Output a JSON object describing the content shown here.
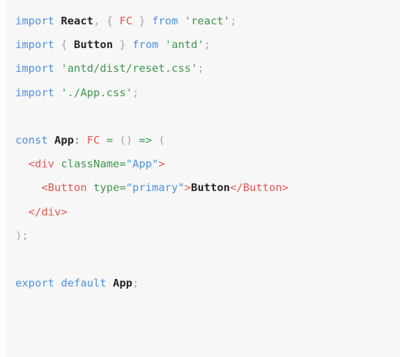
{
  "editor": {
    "language": "tsx",
    "background_color": "#f7f7f7",
    "default_text_color": "#333333",
    "theme_colors": {
      "keyword": "#4b90e2",
      "string": "#3f9650",
      "type": "#e8564f",
      "punctuation": "#a6a6a6",
      "identifier": "#262626",
      "operator": "#3f9650",
      "jsx_tag": "#e8564f",
      "jsx_attribute": "#3f9650",
      "jsx_attribute_value": "#4b90e2"
    },
    "full_text": "import React, { FC } from 'react';\nimport { Button } from 'antd';\nimport 'antd/dist/reset.css';\nimport './App.css';\n\nconst App: FC = () => (\n  <div className=\"App\">\n    <Button type=\"primary\">Button</Button>\n  </div>\n);\n\nexport default App;",
    "lines": [
      {
        "id": "line-1",
        "tokens": [
          {
            "text": "import",
            "kind": "keyword"
          },
          {
            "text": " ",
            "kind": "plain"
          },
          {
            "text": "React",
            "kind": "ident"
          },
          {
            "text": ",",
            "kind": "punct"
          },
          {
            "text": " ",
            "kind": "plain"
          },
          {
            "text": "{",
            "kind": "punct"
          },
          {
            "text": " ",
            "kind": "plain"
          },
          {
            "text": "FC",
            "kind": "type"
          },
          {
            "text": " ",
            "kind": "plain"
          },
          {
            "text": "}",
            "kind": "punct"
          },
          {
            "text": " ",
            "kind": "plain"
          },
          {
            "text": "from",
            "kind": "keyword"
          },
          {
            "text": " ",
            "kind": "plain"
          },
          {
            "text": "'react'",
            "kind": "string"
          },
          {
            "text": ";",
            "kind": "punct"
          }
        ]
      },
      {
        "id": "line-2",
        "tokens": [
          {
            "text": "import",
            "kind": "keyword"
          },
          {
            "text": " ",
            "kind": "plain"
          },
          {
            "text": "{",
            "kind": "punct"
          },
          {
            "text": " ",
            "kind": "plain"
          },
          {
            "text": "Button",
            "kind": "ident"
          },
          {
            "text": " ",
            "kind": "plain"
          },
          {
            "text": "}",
            "kind": "punct"
          },
          {
            "text": " ",
            "kind": "plain"
          },
          {
            "text": "from",
            "kind": "keyword"
          },
          {
            "text": " ",
            "kind": "plain"
          },
          {
            "text": "'antd'",
            "kind": "string"
          },
          {
            "text": ";",
            "kind": "punct"
          }
        ]
      },
      {
        "id": "line-3",
        "tokens": [
          {
            "text": "import",
            "kind": "keyword"
          },
          {
            "text": " ",
            "kind": "plain"
          },
          {
            "text": "'antd/dist/reset.css'",
            "kind": "string"
          },
          {
            "text": ";",
            "kind": "punct"
          }
        ]
      },
      {
        "id": "line-4",
        "tokens": [
          {
            "text": "import",
            "kind": "keyword"
          },
          {
            "text": " ",
            "kind": "plain"
          },
          {
            "text": "'./App.css'",
            "kind": "string"
          },
          {
            "text": ";",
            "kind": "punct"
          }
        ]
      },
      {
        "id": "line-5",
        "tokens": []
      },
      {
        "id": "line-6",
        "tokens": [
          {
            "text": "const",
            "kind": "keyword"
          },
          {
            "text": " ",
            "kind": "plain"
          },
          {
            "text": "App",
            "kind": "ident"
          },
          {
            "text": ":",
            "kind": "operator"
          },
          {
            "text": " ",
            "kind": "plain"
          },
          {
            "text": "FC",
            "kind": "type"
          },
          {
            "text": " ",
            "kind": "plain"
          },
          {
            "text": "=",
            "kind": "operator"
          },
          {
            "text": " ",
            "kind": "plain"
          },
          {
            "text": "()",
            "kind": "punct"
          },
          {
            "text": " ",
            "kind": "plain"
          },
          {
            "text": "=>",
            "kind": "operator"
          },
          {
            "text": " ",
            "kind": "plain"
          },
          {
            "text": "(",
            "kind": "punct"
          }
        ]
      },
      {
        "id": "line-7",
        "tokens": [
          {
            "text": "  ",
            "kind": "plain"
          },
          {
            "text": "<div",
            "kind": "tag"
          },
          {
            "text": " ",
            "kind": "plain"
          },
          {
            "text": "className=",
            "kind": "attr"
          },
          {
            "text": "\"App\"",
            "kind": "attrval"
          },
          {
            "text": ">",
            "kind": "tag"
          }
        ]
      },
      {
        "id": "line-8",
        "tokens": [
          {
            "text": "    ",
            "kind": "plain"
          },
          {
            "text": "<Button",
            "kind": "tag"
          },
          {
            "text": " ",
            "kind": "plain"
          },
          {
            "text": "type=",
            "kind": "attr"
          },
          {
            "text": "\"primary\"",
            "kind": "attrval"
          },
          {
            "text": ">",
            "kind": "tag"
          },
          {
            "text": "Button",
            "kind": "text"
          },
          {
            "text": "</Button>",
            "kind": "tag"
          }
        ]
      },
      {
        "id": "line-9",
        "tokens": [
          {
            "text": "  ",
            "kind": "plain"
          },
          {
            "text": "</div>",
            "kind": "tag"
          }
        ]
      },
      {
        "id": "line-10",
        "tokens": [
          {
            "text": ")",
            "kind": "punct"
          },
          {
            "text": ";",
            "kind": "punct"
          }
        ]
      },
      {
        "id": "line-11",
        "tokens": []
      },
      {
        "id": "line-12",
        "tokens": [
          {
            "text": "export",
            "kind": "keyword"
          },
          {
            "text": " ",
            "kind": "plain"
          },
          {
            "text": "default",
            "kind": "keyword"
          },
          {
            "text": " ",
            "kind": "plain"
          },
          {
            "text": "App",
            "kind": "ident"
          },
          {
            "text": ";",
            "kind": "punct"
          }
        ]
      }
    ]
  }
}
